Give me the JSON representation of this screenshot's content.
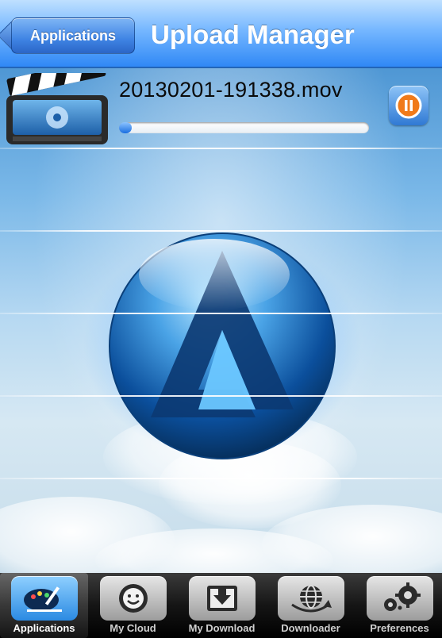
{
  "nav": {
    "back_label": "Applications",
    "title": "Upload Manager"
  },
  "upload": {
    "filename": "20130201-191338.mov",
    "progress": 0.03
  },
  "tabs": [
    {
      "label": "Applications",
      "icon": "palette-icon",
      "active": true
    },
    {
      "label": "My Cloud",
      "icon": "cloud-smiley-icon",
      "active": false
    },
    {
      "label": "My Download",
      "icon": "download-tray-icon",
      "active": false
    },
    {
      "label": "Downloader",
      "icon": "globe-download-icon",
      "active": false
    },
    {
      "label": "Preferences",
      "icon": "gears-icon",
      "active": false
    }
  ],
  "colors": {
    "nav_blue": "#2d86f5",
    "tab_active": "#2b8ae2",
    "pause_orange": "#f07a1a"
  }
}
